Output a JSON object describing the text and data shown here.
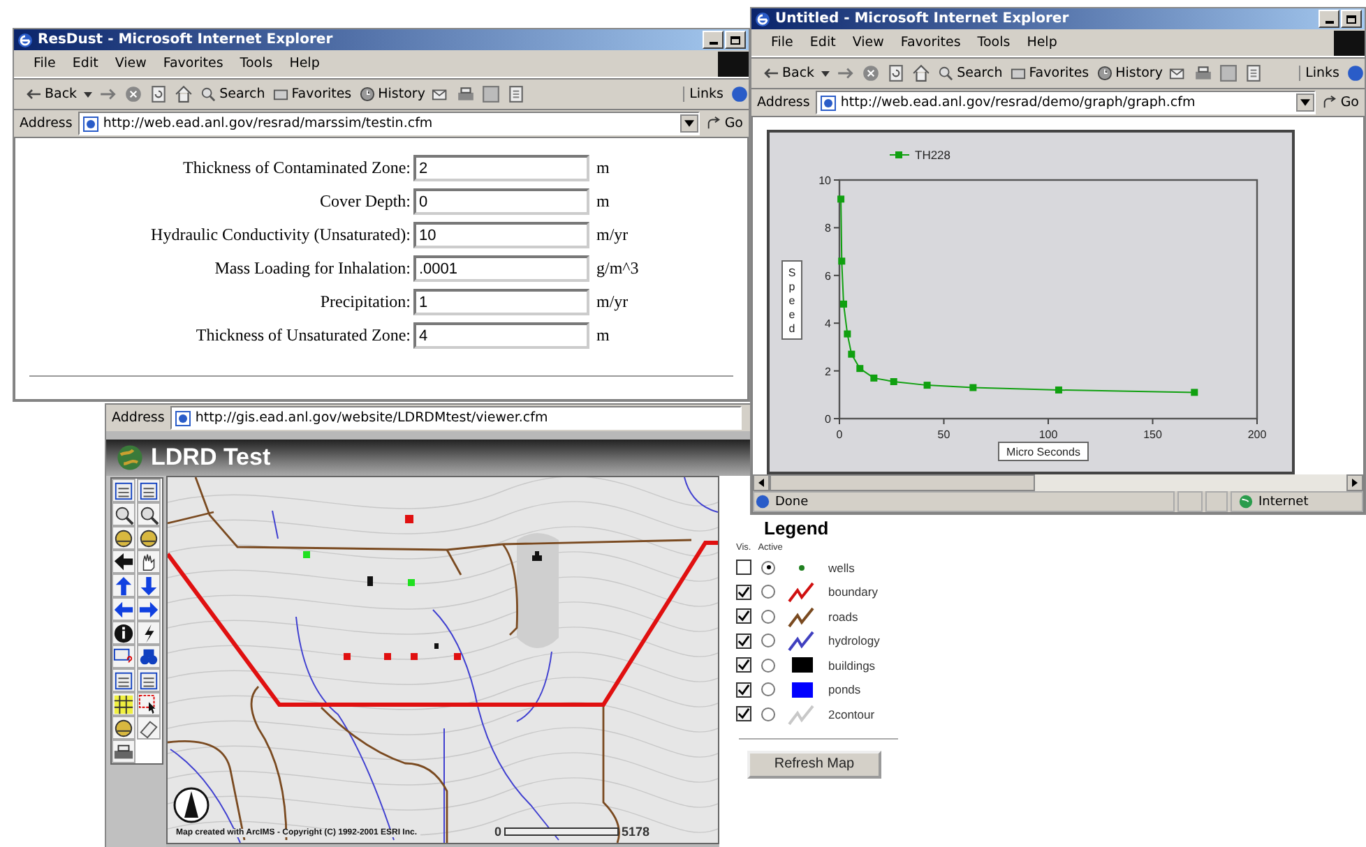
{
  "windows": [
    {
      "title": "ResDust - Microsoft Internet Explorer",
      "menu": [
        "File",
        "Edit",
        "View",
        "Favorites",
        "Tools",
        "Help"
      ],
      "toolbar": {
        "back": "Back",
        "search": "Search",
        "favorites": "Favorites",
        "history": "History",
        "links": "Links"
      },
      "address": {
        "label": "Address",
        "url": "http://web.ead.anl.gov/resrad/marssim/testin.cfm",
        "go": "Go"
      }
    },
    {
      "title": "Untitled - Microsoft Internet Explorer",
      "menu": [
        "File",
        "Edit",
        "View",
        "Favorites",
        "Tools",
        "Help"
      ],
      "toolbar": {
        "back": "Back",
        "search": "Search",
        "favorites": "Favorites",
        "history": "History",
        "links": "Links"
      },
      "address": {
        "label": "Address",
        "url": "http://web.ead.anl.gov/resrad/demo/graph/graph.cfm",
        "go": "Go"
      }
    }
  ],
  "form": {
    "fields": [
      {
        "label": "Thickness of Contaminated Zone:",
        "value": "2",
        "unit": "m"
      },
      {
        "label": "Cover Depth:",
        "value": "0",
        "unit": "m"
      },
      {
        "label": "Hydraulic Conductivity (Unsaturated):",
        "value": "10",
        "unit": "m/yr"
      },
      {
        "label": "Mass Loading for Inhalation:",
        "value": ".0001",
        "unit": "g/m^3"
      },
      {
        "label": "Precipitation:",
        "value": "1",
        "unit": "m/yr"
      },
      {
        "label": "Thickness of Unsaturated Zone:",
        "value": "4",
        "unit": "m"
      }
    ]
  },
  "graph": {
    "chart_data": {
      "type": "line",
      "xlabel": "Micro Seconds",
      "ylabel": "Speed",
      "xlim": [
        0,
        200
      ],
      "ylim": [
        0,
        10
      ],
      "xticks": [
        0,
        50,
        100,
        150,
        200
      ],
      "yticks": [
        0,
        2,
        4,
        6,
        8,
        10
      ],
      "x": [
        0.7,
        1.1,
        2,
        3.8,
        5.8,
        9.8,
        16.5,
        26,
        42,
        64,
        105,
        170
      ],
      "series": [
        {
          "name": "TH228",
          "color": "#10a010",
          "marker": "square",
          "values": [
            9.2,
            6.6,
            4.8,
            3.55,
            2.7,
            2.1,
            1.7,
            1.55,
            1.4,
            1.3,
            1.2,
            1.1
          ]
        }
      ]
    },
    "status": {
      "text": "Done",
      "zone": "Internet"
    }
  },
  "map_window": {
    "address": {
      "label": "Address",
      "url": "http://gis.ead.anl.gov/website/LDRDMtest/viewer.cfm"
    },
    "title": "LDRD Test",
    "copyright": "Map created with ArcIMS - Copyright (C) 1992-2001 ESRI Inc.",
    "scale_start": "0",
    "scale_end": "5178",
    "legend": {
      "title": "Legend",
      "vis_header": "Vis.",
      "active_header": "Active",
      "button": "Refresh Map",
      "layers": [
        {
          "label": "wells",
          "visible": false,
          "selected": true,
          "kind": "dot",
          "color": "#208020"
        },
        {
          "label": "boundary",
          "visible": true,
          "selected": false,
          "kind": "line",
          "color": "#d01010"
        },
        {
          "label": "roads",
          "visible": true,
          "selected": false,
          "kind": "line",
          "color": "#7a4a20"
        },
        {
          "label": "hydrology",
          "visible": true,
          "selected": false,
          "kind": "line",
          "color": "#4040c0"
        },
        {
          "label": "buildings",
          "visible": true,
          "selected": false,
          "kind": "square",
          "color": "#000000"
        },
        {
          "label": "ponds",
          "visible": true,
          "selected": false,
          "kind": "square",
          "color": "#0000ff"
        },
        {
          "label": "2contour",
          "visible": true,
          "selected": false,
          "kind": "line",
          "color": "#c8c8c8"
        }
      ]
    }
  }
}
